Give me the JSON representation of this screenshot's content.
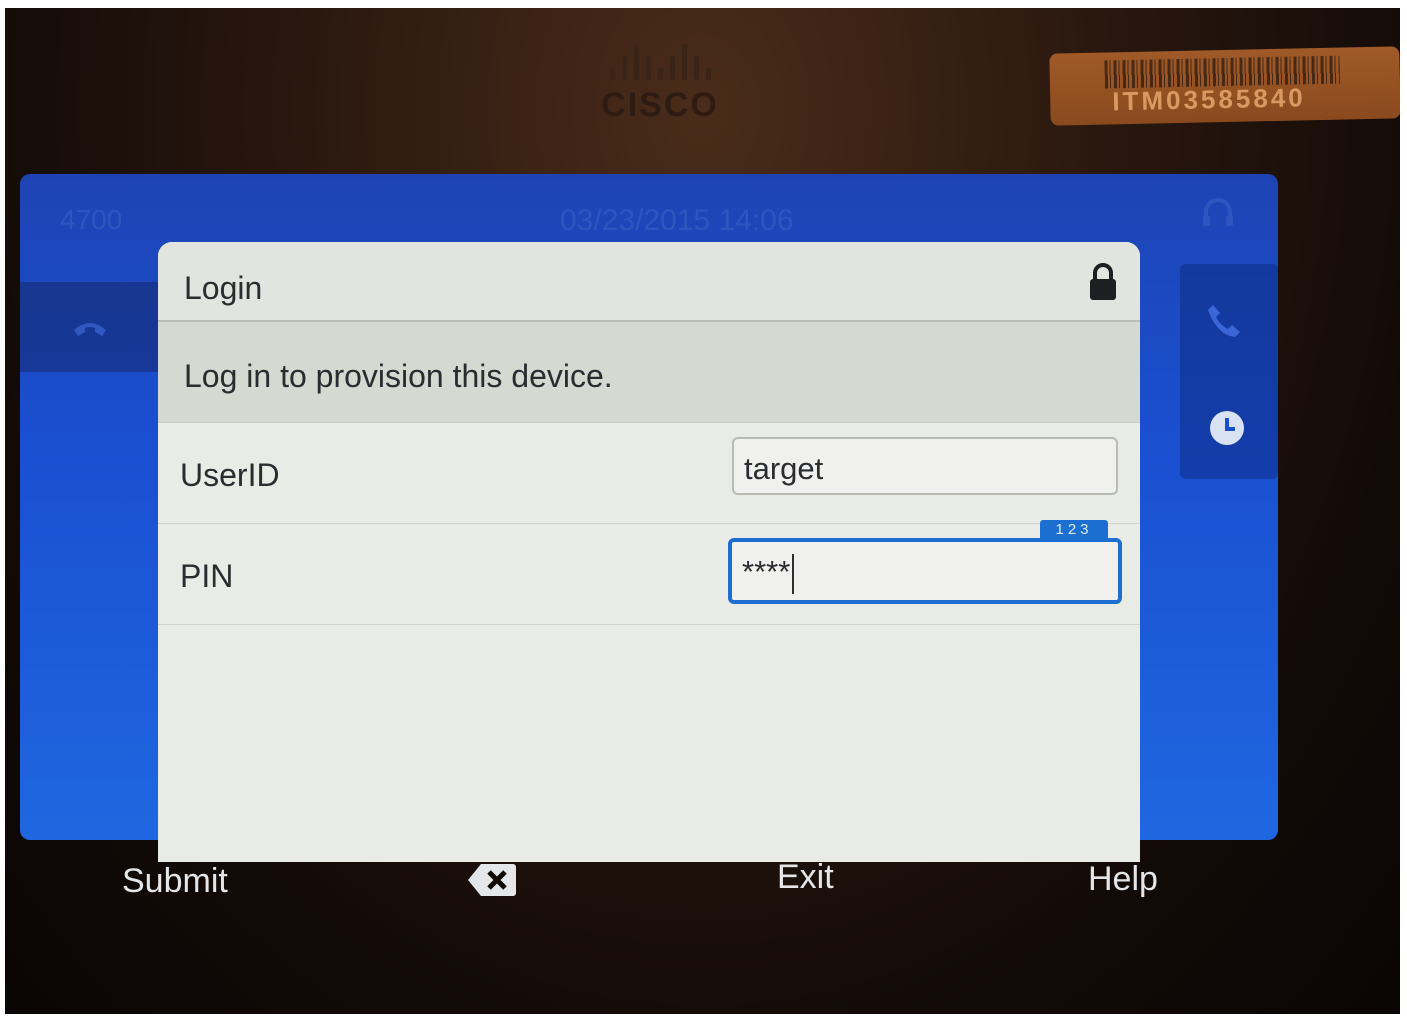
{
  "device": {
    "brand": "CISCO",
    "asset_tag": "ITM03585840"
  },
  "status_bar": {
    "extension": "4700",
    "datetime": "03/23/2015 14:06",
    "headset_icon": "headset-icon"
  },
  "dialog": {
    "title": "Login",
    "lock_icon": "lock-icon",
    "description": "Log in to provision this device.",
    "fields": [
      {
        "label": "UserID",
        "value": "target"
      },
      {
        "label": "PIN",
        "value": "****",
        "input_mode": "123"
      }
    ]
  },
  "softkeys": {
    "submit": "Submit",
    "backspace_icon": "backspace-icon",
    "exit": "Exit",
    "help": "Help"
  },
  "colors": {
    "screen_blue": "#1a4fd0",
    "focus_blue": "#1c6fd0",
    "dialog_bg": "#e9ece6"
  }
}
